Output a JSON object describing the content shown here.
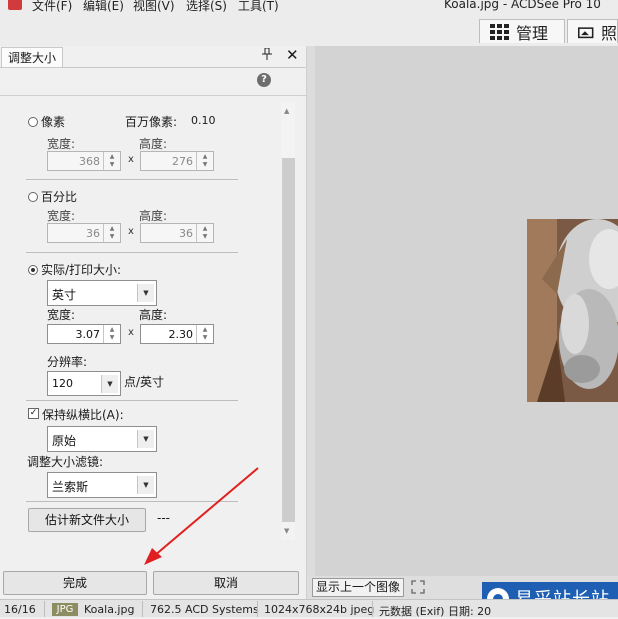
{
  "menu": {
    "items": [
      "文件(F)",
      "编辑(E)",
      "视图(V)",
      "选择(S)",
      "工具(T)"
    ],
    "window_title": "Koala.jpg - ACDSee Pro 10"
  },
  "modes": {
    "manage": "管理",
    "photos": "照"
  },
  "panel": {
    "tab_label": "调整大小",
    "pin": "📌",
    "close": "✕",
    "help": "?",
    "pixels": {
      "radio_label": "像素",
      "megapixels_label": "百万像素:",
      "megapixels_value": "0.10",
      "width_label": "宽度:",
      "width_value": "368",
      "height_label": "高度:",
      "height_value": "276",
      "x": "x"
    },
    "percent": {
      "radio_label": "百分比",
      "width_label": "宽度:",
      "width_value": "36",
      "height_label": "高度:",
      "height_value": "36",
      "x": "x"
    },
    "print": {
      "radio_label": "实际/打印大小:",
      "unit_value": "英寸",
      "width_label": "宽度:",
      "width_value": "3.07",
      "height_label": "高度:",
      "height_value": "2.30",
      "x": "x",
      "resolution_label": "分辨率:",
      "resolution_value": "120",
      "resolution_unit": "点/英寸"
    },
    "aspect": {
      "checkbox_label": "保持纵横比(A):",
      "checked_mark": "✓",
      "value": "原始"
    },
    "filter": {
      "label": "调整大小滤镜:",
      "value": "兰索斯"
    },
    "estimate": {
      "button_label": "估计新文件大小",
      "result": "---"
    },
    "done_label": "完成",
    "cancel_label": "取消"
  },
  "viewer": {
    "show_prev_label": "显示上一个图像"
  },
  "watermark": {
    "text": "易采站长站"
  },
  "statusbar": {
    "index": "16/16",
    "type_badge": "JPG",
    "filename": "Koala.jpg",
    "size": "762.5 ACD Systems",
    "dimensions": "1024x768x24b jpeg",
    "metadata": "元数据 (Exif) 日期: 20"
  },
  "colors": {
    "accent_blue": "#1e5fb4",
    "arrow_red": "#e02020"
  }
}
